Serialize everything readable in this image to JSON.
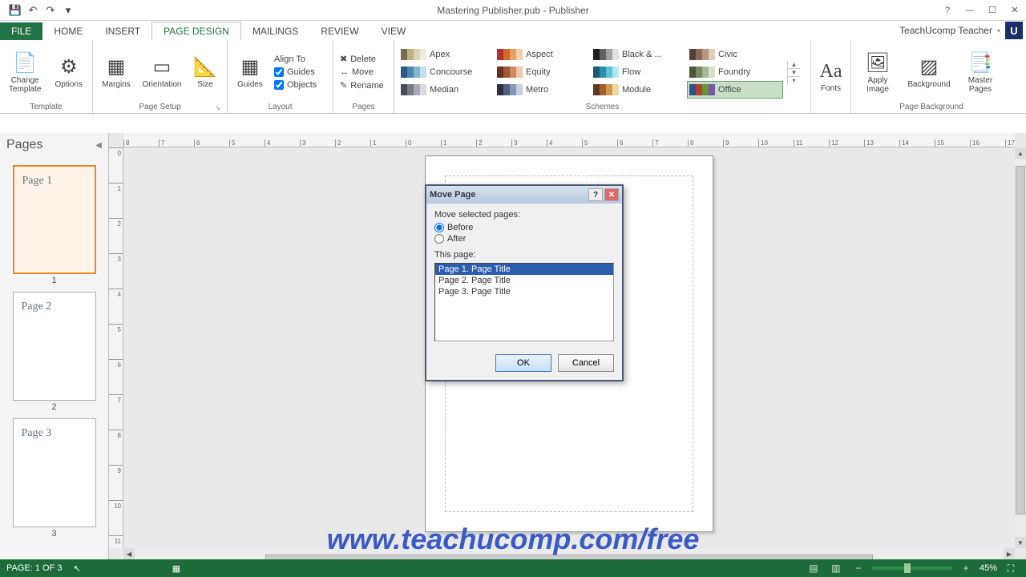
{
  "titlebar": {
    "title": "Mastering Publisher.pub - Publisher"
  },
  "user": {
    "name": "TeachUcomp Teacher",
    "badge": "U"
  },
  "tabs": {
    "file": "FILE",
    "home": "HOME",
    "insert": "INSERT",
    "page_design": "PAGE DESIGN",
    "mailings": "MAILINGS",
    "review": "REVIEW",
    "view": "VIEW"
  },
  "ribbon": {
    "template": {
      "change_template": "Change Template",
      "options": "Options",
      "label": "Template"
    },
    "page_setup": {
      "margins": "Margins",
      "orientation": "Orientation",
      "size": "Size",
      "label": "Page Setup"
    },
    "layout": {
      "guides": "Guides",
      "align_to": "Align To",
      "chk_guides": "Guides",
      "chk_objects": "Objects",
      "label": "Layout"
    },
    "pages": {
      "delete": "Delete",
      "move": "Move",
      "rename": "Rename",
      "label": "Pages"
    },
    "schemes": {
      "label": "Schemes",
      "items": [
        {
          "name": "Apex",
          "c": [
            "#7a6a50",
            "#c0b080",
            "#e0d4b0",
            "#f0eadb"
          ]
        },
        {
          "name": "Aspect",
          "c": [
            "#b03030",
            "#d46a30",
            "#e8a060",
            "#f4d0b0"
          ]
        },
        {
          "name": "Black & ...",
          "c": [
            "#202020",
            "#606060",
            "#a0a0a0",
            "#e0e0e0"
          ]
        },
        {
          "name": "Civic",
          "c": [
            "#5a4038",
            "#8a6a58",
            "#b89880",
            "#e0ccb8"
          ]
        },
        {
          "name": "Concourse",
          "c": [
            "#2a5a80",
            "#4a88b0",
            "#80b8d8",
            "#c0e0f0"
          ]
        },
        {
          "name": "Equity",
          "c": [
            "#6a3020",
            "#a05838",
            "#d08860",
            "#f0c8a8"
          ]
        },
        {
          "name": "Flow",
          "c": [
            "#1a5a70",
            "#2a90b0",
            "#60c0d8",
            "#b0e8f0"
          ]
        },
        {
          "name": "Foundry",
          "c": [
            "#4a5840",
            "#788860",
            "#a8b890",
            "#d8e0c8"
          ]
        },
        {
          "name": "Median",
          "c": [
            "#4a4a58",
            "#787888",
            "#a8a8b8",
            "#d8d8e0"
          ]
        },
        {
          "name": "Metro",
          "c": [
            "#2a3040",
            "#506080",
            "#8898b8",
            "#c8d0e0"
          ]
        },
        {
          "name": "Module",
          "c": [
            "#603820",
            "#a06030",
            "#d09850",
            "#f0d8a0"
          ]
        },
        {
          "name": "Office",
          "c": [
            "#30508a",
            "#b04030",
            "#6a9038",
            "#7858a0"
          ]
        }
      ]
    },
    "fonts": {
      "fonts": "Fonts"
    },
    "page_background": {
      "apply_image": "Apply Image",
      "background": "Background",
      "master_pages": "Master Pages",
      "label": "Page Background"
    }
  },
  "pages_panel": {
    "header": "Pages",
    "thumbs": [
      {
        "title": "Page 1",
        "num": "1"
      },
      {
        "title": "Page 2",
        "num": "2"
      },
      {
        "title": "Page 3",
        "num": "3"
      }
    ]
  },
  "ruler_h": [
    "8",
    "7",
    "6",
    "5",
    "4",
    "3",
    "2",
    "1",
    "0",
    "1",
    "2",
    "3",
    "4",
    "5",
    "6",
    "7",
    "8",
    "9",
    "10",
    "11",
    "12",
    "13",
    "14",
    "15",
    "16",
    "17"
  ],
  "ruler_v": [
    "0",
    "1",
    "2",
    "3",
    "4",
    "5",
    "6",
    "7",
    "8",
    "9",
    "10",
    "11"
  ],
  "dialog": {
    "title": "Move Page",
    "move_label": "Move selected pages:",
    "before": "Before",
    "after": "After",
    "this_page": "This page:",
    "items": [
      "Page 1. Page Title",
      "Page 2. Page Title",
      "Page 3. Page Title"
    ],
    "ok": "OK",
    "cancel": "Cancel"
  },
  "watermark": "www.teachucomp.com/free",
  "statusbar": {
    "page": "PAGE: 1 OF 3",
    "zoom": "45%"
  }
}
